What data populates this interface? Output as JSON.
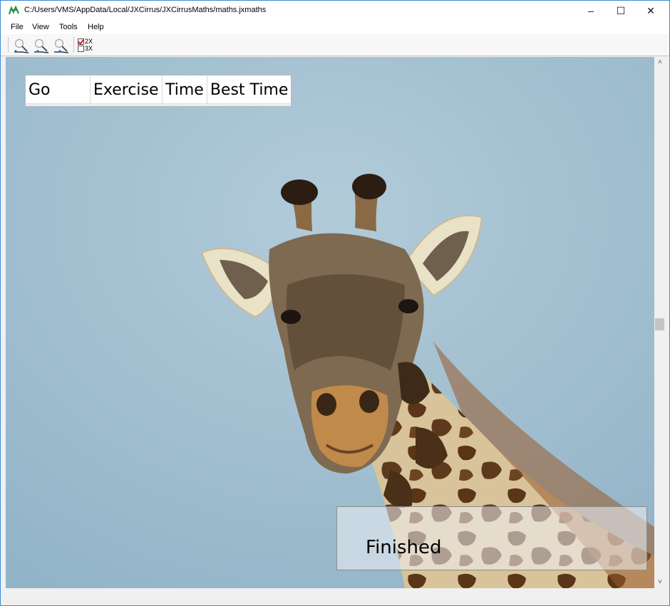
{
  "window": {
    "title": "C:/Users/VMS/AppData/Local/JXCirrus/JXCirrusMaths/maths.jxmaths",
    "min_glyph": "–",
    "max_glyph": "☐",
    "close_glyph": "✕"
  },
  "menu": {
    "items": [
      "File",
      "View",
      "Tools",
      "Help"
    ]
  },
  "toolbar": {
    "tools": [
      "zoom-in-icon",
      "zoom-reset-icon",
      "zoom-out-icon"
    ],
    "options": [
      {
        "label": "2X",
        "checked": true
      },
      {
        "label": "3X",
        "checked": false
      }
    ]
  },
  "score_table": {
    "headers": [
      "Go",
      "Exercise",
      "Time",
      "Best Time"
    ]
  },
  "status": {
    "message": "Finished"
  },
  "scrollbar": {
    "up_glyph": "˄",
    "down_glyph": "˅"
  },
  "colors": {
    "sky": "#a3c1d3",
    "accent": "#3b8ad8"
  }
}
